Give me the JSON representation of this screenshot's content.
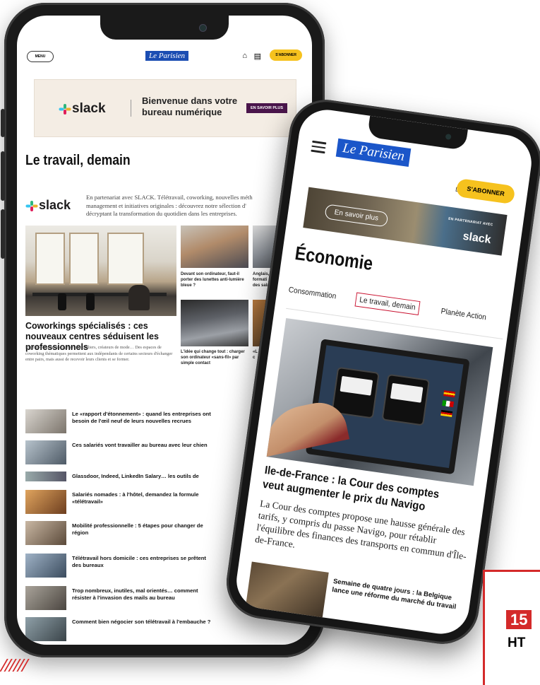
{
  "phone1": {
    "menu_label": "MENU",
    "logo": "Le Parisien",
    "subscribe_label": "S'ABONNER",
    "ad": {
      "brand": "slack",
      "text": "Bienvenue dans votre bureau numérique",
      "cta": "EN SAVOIR PLUS"
    },
    "section_title": "Le travail, demain",
    "partner_brand": "slack",
    "partner_text_1": "En partenariat avec SLACK. Télétravail, coworking, nouvelles méth",
    "partner_text_2": "management et initiatives originales : découvrez notre sélection d'",
    "partner_text_3": "décryptant la transformation du quotidien dans les entreprises.",
    "featured_title": "Coworkings spécialisés : ces nouveaux centres séduisent les professionnels",
    "featured_text": "Experts-comptables, agents immobiliers, créateurs de mode… Des espaces de coworking thématiques permettent aux indépendants de certains secteurs d'échanger entre pairs, mais aussi de recevoir leurs clients et se former.",
    "side_caption_1": "Devant son ordinateur, faut-il porter des lunettes anti-lumière bleue ?",
    "side_caption_2": "L'idée qui change tout : charger son ordinateur «sans-fil» par simple contact",
    "side_caption_3a": "Anglais,",
    "side_caption_3b": "formati",
    "side_caption_3c": "des salá",
    "side_caption_4a": "«L",
    "side_caption_4b": "c",
    "list": [
      {
        "text": "Le «rapport d'étonnement» : quand les entreprises ont besoin de l'œil neuf de leurs nouvelles recrues"
      },
      {
        "text": "Ces salariés vont travailler au bureau avec leur chien"
      },
      {
        "text": "Glassdoor, Indeed, LinkedIn Salary… les outils de"
      },
      {
        "text": "Salariés nomades : à l'hôtel, demandez la formule «télétravail»"
      },
      {
        "text": "Mobilité professionnelle : 5 étapes pour changer de région"
      },
      {
        "text": "Télétravail hors domicile : ces entreprises se prêtent des bureaux"
      },
      {
        "text": "Trop nombreux, inutiles, mal orientés… comment résister à l'invasion des mails au bureau"
      },
      {
        "text": "Comment bien négocier son télétravail à l'embauche ?"
      }
    ]
  },
  "phone2": {
    "logo": "Le Parisien",
    "subscribe_label": "S'ABONNER",
    "ad": {
      "cta": "En savoir plus",
      "small": "EN PARTENARIAT AVEC",
      "brand": "slack"
    },
    "section_title": "Économie",
    "tabs": [
      "Consommation",
      "Le travail, demain",
      "Planète Action"
    ],
    "hero_title": "Ile-de-France : la Cour des comptes veut augmenter le prix du Navigo",
    "hero_text": "La Cour des comptes propose une hausse générale des tarifs, y compris du passe Navigo, pour rétablir l'équilibre des finances des transports en commun d'Île-de-France.",
    "bottom_title": "Semaine de quatre jours : la Belgique lance une réforme du marché du travail"
  },
  "badge": {
    "number": "15",
    "label": "HT"
  },
  "colors": {
    "brand_blue": "#1b56c9",
    "subscribe_yellow": "#f6c21e",
    "accent_red": "#c8102e",
    "slack_purple": "#4a154b"
  }
}
